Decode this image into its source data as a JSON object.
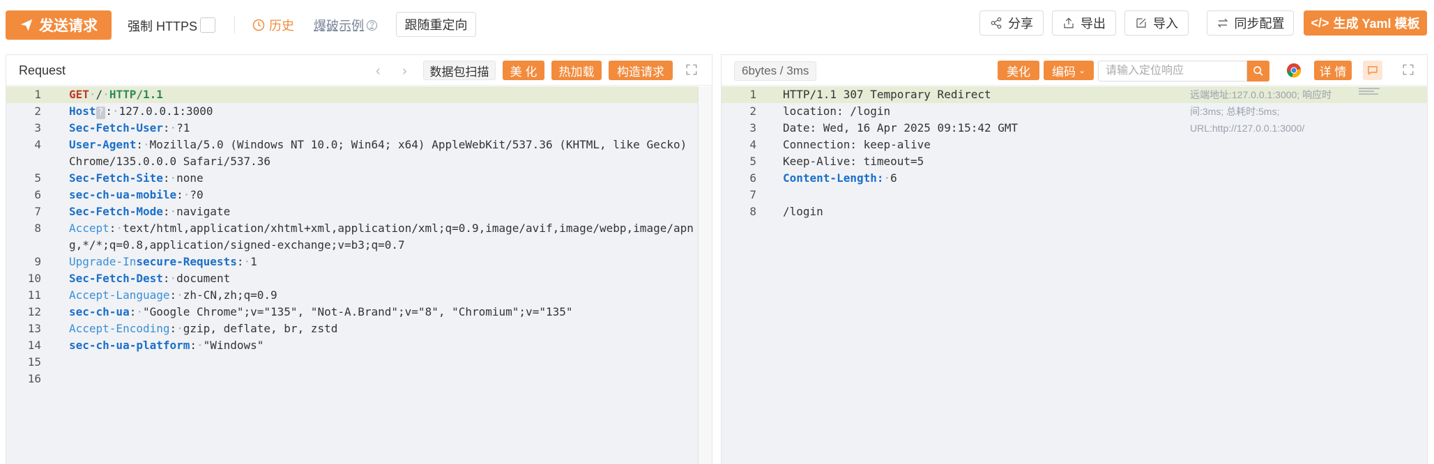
{
  "toolbar": {
    "send_label": "发送请求",
    "force_https_label": "强制 HTTPS",
    "history_label": "历史",
    "burst_example_label": "爆破示例",
    "follow_redirect_label": "跟随重定向",
    "share_label": "分享",
    "export_label": "导出",
    "import_label": "导入",
    "sync_label": "同步配置",
    "yaml_label": "生成 Yaml 模板"
  },
  "request_panel": {
    "title": "Request",
    "scan_label": "数据包扫描",
    "beautify_label": "美 化",
    "hot_reload_label": "热加载",
    "construct_label": "构造请求",
    "lines": [
      {
        "n": "1"
      },
      {
        "n": "2"
      },
      {
        "n": "3"
      },
      {
        "n": "4"
      },
      {
        "n": "5"
      },
      {
        "n": "6"
      },
      {
        "n": "7"
      },
      {
        "n": "8"
      },
      {
        "n": "9"
      },
      {
        "n": "10"
      },
      {
        "n": "11"
      },
      {
        "n": "12"
      },
      {
        "n": "13"
      },
      {
        "n": "14"
      },
      {
        "n": "15"
      },
      {
        "n": "16"
      }
    ],
    "content": {
      "l1_method": "GET",
      "l1_path": "/",
      "l1_proto": "HTTP/1.1",
      "l2_key": "Host",
      "l2_badge": "?",
      "l2_val": "127.0.0.1:3000",
      "l3_key": "Sec-Fetch-User",
      "l3_val": "?1",
      "l4_key": "User-Agent",
      "l4_val": "Mozilla/5.0 (Windows NT 10.0; Win64; x64) AppleWebKit/537.36 (KHTML, like Gecko) Chrome/135.0.0.0 Safari/537.36",
      "l5_key": "Sec-Fetch-Site",
      "l5_val": "none",
      "l6_key": "sec-ch-ua-mobile",
      "l6_val": "?0",
      "l7_key": "Sec-Fetch-Mode",
      "l7_val": "navigate",
      "l8_key": "Accept",
      "l8_val": "text/html,application/xhtml+xml,application/xml;q=0.9,image/avif,image/webp,image/apng,*/*;q=0.8,application/signed-exchange;v=b3;q=0.7",
      "l9_key_a": "Upgrade-In",
      "l9_key_b": "secure-Requests",
      "l9_val": "1",
      "l10_key": "Sec-Fetch-Dest",
      "l10_val": "document",
      "l11_key": "Accept-Language",
      "l11_val": "zh-CN,zh;q=0.9",
      "l12_key": "sec-ch-ua",
      "l12_val": "\"Google Chrome\";v=\"135\", \"Not-A.Brand\";v=\"8\", \"Chromium\";v=\"135\"",
      "l13_key": "Accept-Encoding",
      "l13_val": "gzip, deflate, br, zstd",
      "l14_key": "sec-ch-ua-platform",
      "l14_val": "\"Windows\""
    }
  },
  "response_panel": {
    "size_label": "6bytes / 3ms",
    "beautify_label": "美化",
    "encoding_label": "编码",
    "search_placeholder": "请输入定位响应",
    "detail_label": "详 情",
    "meta_info": "远端地址:127.0.0.1:3000; 响应时间:3ms; 总耗时:5ms; URL:http://127.0.0.1:3000/",
    "lines": [
      "1",
      "2",
      "3",
      "4",
      "5",
      "6",
      "7",
      "8"
    ],
    "content": {
      "l1": "HTTP/1.1 307 Temporary Redirect",
      "l2": "location: /login",
      "l3": "Date: Wed, 16 Apr 2025 09:15:42 GMT",
      "l4": "Connection: keep-alive",
      "l5": "Keep-Alive: timeout=5",
      "l6_key": "Content-Length:",
      "l6_val": "6",
      "l8": "/login"
    }
  },
  "colors": {
    "accent": "#f28b3c",
    "editor_bg": "#f1f2f5",
    "highlight_line": "#e6ecd6",
    "key_blue": "#1a6fc9"
  }
}
